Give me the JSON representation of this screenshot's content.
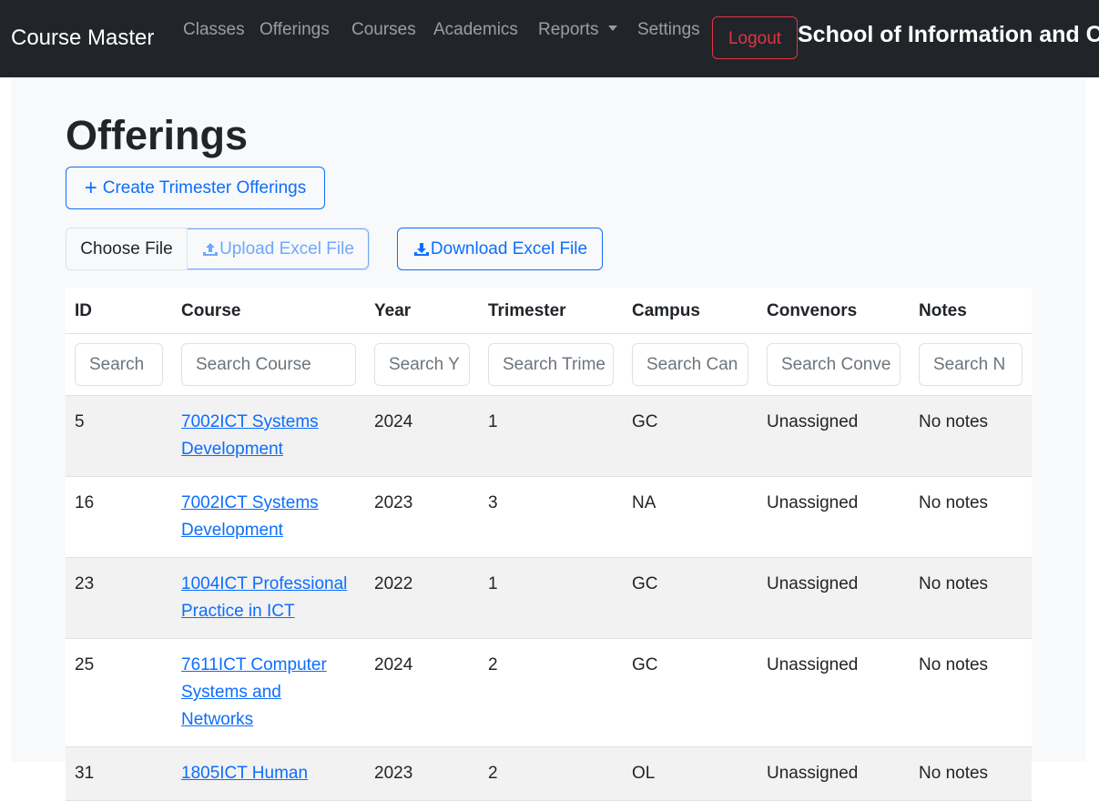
{
  "navbar": {
    "brand": "Course Master",
    "links": [
      "Classes",
      "Offerings",
      "Courses",
      "Academics",
      "Reports",
      "Settings"
    ],
    "logout": "Logout",
    "school": "School of Information and Co"
  },
  "page": {
    "title": "Offerings",
    "create_button": "Create Trimester Offerings",
    "choose_file": "Choose File",
    "upload_button": "Upload Excel File",
    "download_button": "Download Excel File"
  },
  "table": {
    "headers": [
      "ID",
      "Course",
      "Year",
      "Trimester",
      "Campus",
      "Convenors",
      "Notes"
    ],
    "search_placeholders": [
      "Search",
      "Search Course",
      "Search Y",
      "Search Trime",
      "Search Can",
      "Search Conve",
      "Search N"
    ],
    "rows": [
      {
        "id": "5",
        "course": "7002ICT Systems Development",
        "year": "2024",
        "trimester": "1",
        "campus": "GC",
        "convenors": "Unassigned",
        "notes": "No notes"
      },
      {
        "id": "16",
        "course": "7002ICT Systems Development",
        "year": "2023",
        "trimester": "3",
        "campus": "NA",
        "convenors": "Unassigned",
        "notes": "No notes"
      },
      {
        "id": "23",
        "course": "1004ICT Professional Practice in ICT",
        "year": "2022",
        "trimester": "1",
        "campus": "GC",
        "convenors": "Unassigned",
        "notes": "No notes"
      },
      {
        "id": "25",
        "course": "7611ICT Computer Systems and Networks",
        "year": "2024",
        "trimester": "2",
        "campus": "GC",
        "convenors": "Unassigned",
        "notes": "No notes"
      },
      {
        "id": "31",
        "course": "1805ICT Human",
        "year": "2023",
        "trimester": "2",
        "campus": "OL",
        "convenors": "Unassigned",
        "notes": "No notes"
      }
    ]
  },
  "colors": {
    "navbar_bg": "#212529",
    "primary": "#0d6efd",
    "danger": "#dc3545"
  },
  "icons": {
    "create": "plus-icon",
    "upload": "upload-icon",
    "download": "download-icon",
    "reports_dropdown": "caret-down-icon"
  }
}
